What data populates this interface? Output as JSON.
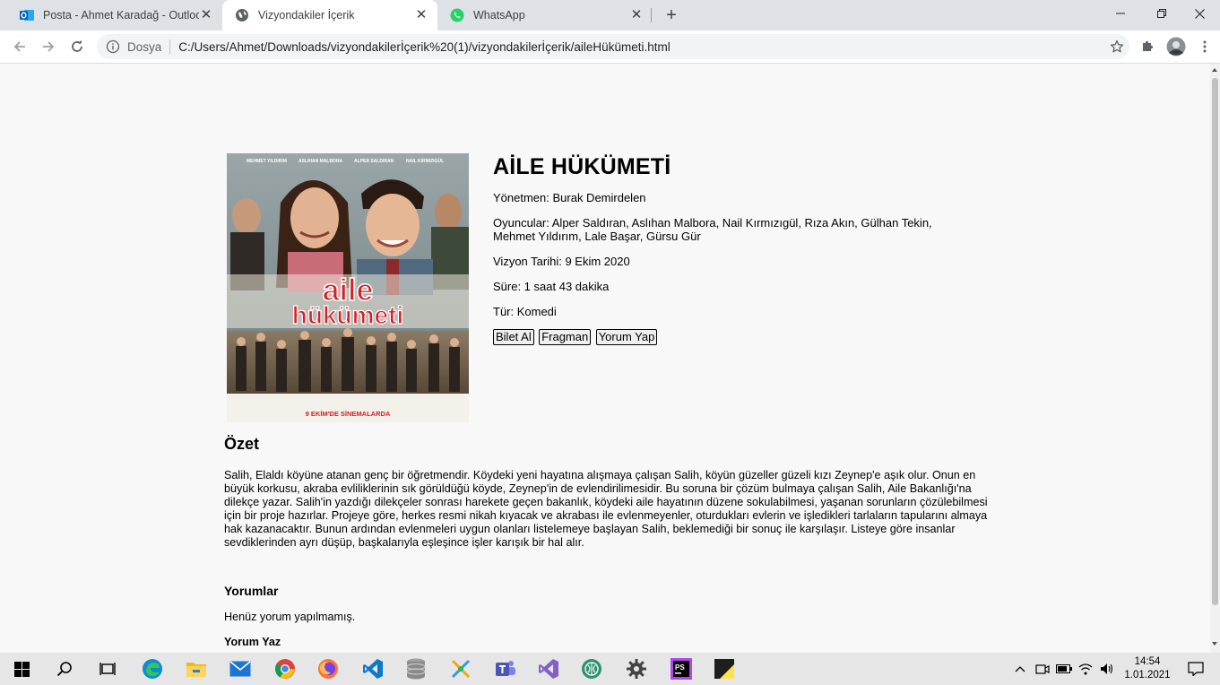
{
  "browser": {
    "tabs": [
      {
        "title": "Posta - Ahmet Karadağ - Outlook",
        "icon": "outlook-icon",
        "active": false
      },
      {
        "title": "Vizyondakiler İçerik",
        "icon": "globe-icon",
        "active": true
      },
      {
        "title": "WhatsApp",
        "icon": "whatsapp-icon",
        "active": false
      }
    ],
    "new_tab": "+",
    "address": {
      "scheme_label": "Dosya",
      "url": "C:/Users/Ahmet/Downloads/vizyondakilerİçerik%20(1)/vizyondakilerİçerik/aileHükümeti.html"
    }
  },
  "page": {
    "poster_text": {
      "line1": "aile",
      "line2": "hükümeti",
      "release": "9 EKİM'DE SİNEMALARDA",
      "cast_top": [
        "MEHMET YILDIRIM",
        "ASLIHAN MALBORA",
        "ALPER SALDIRAN",
        "NAIL KIRMIZIGÜL"
      ]
    },
    "title": "AİLE HÜKÜMETİ",
    "director": "Yönetmen: Burak Demirdelen",
    "cast": "Oyuncular: Alper Saldıran, Aslıhan Malbora, Nail Kırmızıgül, Rıza Akın, Gülhan Tekin, Mehmet Yıldırım, Lale Başar, Gürsu Gür",
    "release_date": "Vizyon Tarihi: 9 Ekim 2020",
    "duration": "Süre: 1 saat 43 dakika",
    "genre": "Tür: Komedi",
    "buttons": {
      "ticket": "Bilet Al",
      "trailer": "Fragman",
      "comment": "Yorum Yap"
    },
    "summary_title": "Özet",
    "summary": "Salih, Elaldı köyüne atanan genç bir öğretmendir. Köydeki yeni hayatına alışmaya çalışan Salih, köyün güzeller güzeli kızı Zeynep'e aşık olur. Onun en büyük korkusu, akraba evliliklerinin sık görüldüğü köyde, Zeynep'in de evlendirilimesidir. Bu soruna bir çözüm bulmaya çalışan Salih, Aile Bakanlığı'na dilekçe yazar. Salih'in yazdığı dilekçeler sonrası harekete geçen bakanlık, köydeki aile hayatının düzene sokulabilmesi, yaşanan sorunların çözülebilmesi için bir proje hazırlar. Projeye göre, herkes resmi nikah kıyacak ve akrabası ile evlenmeyenler, oturdukları evlerin ve işledikleri tarlaların tapularını almaya hak kazanacaktır. Bunun ardından evlenmeleri uygun olanları listelemeye başlayan Salih, beklemediği bir sonuç ile karşılaşır. Listeye göre insanlar sevdiklerinden ayrı düşüp, başkalarıyla eşleşince işler karışık bir hal alır.",
    "comments_title": "Yorumlar",
    "no_comments": "Henüz yorum yapılmamış.",
    "write_comment": "Yorum Yaz"
  },
  "taskbar": {
    "apps": [
      "windows-start-icon",
      "search-icon",
      "task-view-icon",
      "edge-icon",
      "file-explorer-icon",
      "mail-icon",
      "chrome-icon",
      "firefox-icon",
      "vscode-icon",
      "database-icon",
      "network-tool-icon",
      "teams-icon",
      "visual-studio-icon",
      "brain-app-icon",
      "settings-gear-icon",
      "phpstorm-icon",
      "sticky-notes-icon"
    ],
    "time": "14:54",
    "date": "1.01.2021"
  },
  "colors": {
    "tabbar_bg": "#dee1e6",
    "page_bg": "#f8f8f8",
    "taskbar_bg": "#e6e6e6",
    "poster_title_red": "#d62027"
  }
}
